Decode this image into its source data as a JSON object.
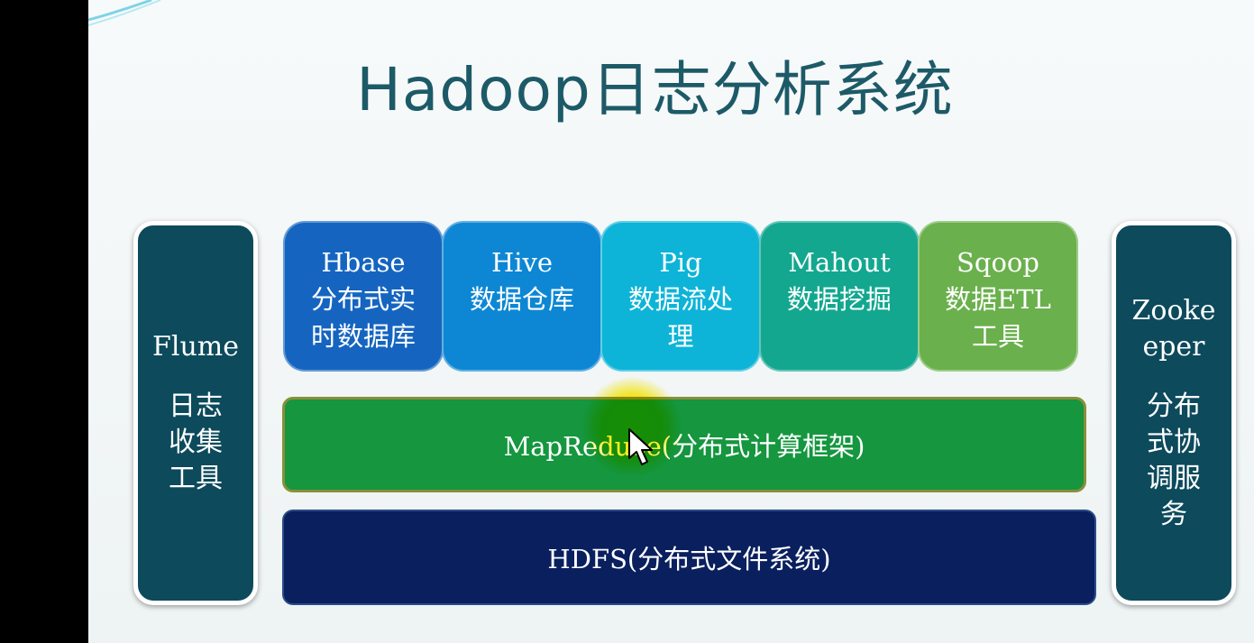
{
  "title": "Hadoop日志分析系统",
  "left_panel": {
    "name": "Flume",
    "desc_lines": [
      "日志",
      "收集",
      "工具"
    ]
  },
  "right_panel": {
    "name_lines": [
      "Zooke",
      "eper"
    ],
    "desc_lines": [
      "分布",
      "式协",
      "调服",
      "务"
    ]
  },
  "components": [
    {
      "name": "Hbase",
      "desc_lines": [
        "分布式实",
        "时数据库"
      ],
      "color": "#1565c0"
    },
    {
      "name": "Hive",
      "desc_lines": [
        "数据仓库"
      ],
      "color": "#0d87d4"
    },
    {
      "name": "Pig",
      "desc_lines": [
        "数据流处",
        "理"
      ],
      "color": "#0db4d8"
    },
    {
      "name": "Mahout",
      "desc_lines": [
        "数据挖掘"
      ],
      "color": "#13a78f"
    },
    {
      "name": "Sqoop",
      "desc_lines": [
        "数据ETL",
        "工具"
      ],
      "color": "#6ab04c"
    }
  ],
  "mapreduce": {
    "label": "MapReduce(分布式计算框架)",
    "color": "#15963f"
  },
  "hdfs": {
    "label": "HDFS(分布式文件系统)",
    "color": "#0a1f5e"
  },
  "colors": {
    "title": "#1d5a68",
    "side_panel": "#0c4a5c"
  },
  "icons": [
    "pointer-cursor-icon"
  ]
}
